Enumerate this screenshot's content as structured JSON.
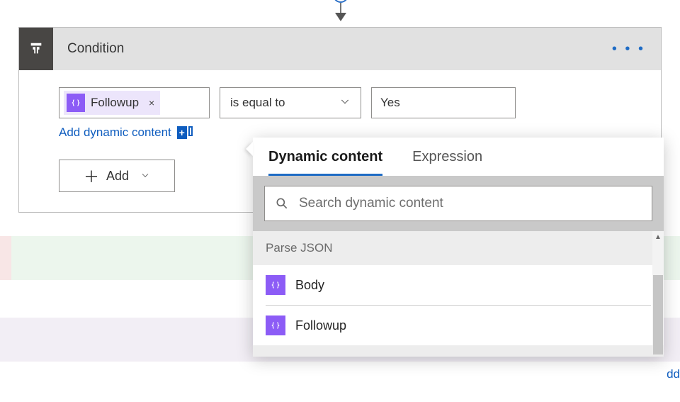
{
  "connector": {
    "plus": "+"
  },
  "card": {
    "title": "Condition",
    "more": "• • •"
  },
  "condition": {
    "token_label": "Followup",
    "token_remove": "×",
    "operator": "is equal to",
    "value": "Yes",
    "dynamic_link": "Add dynamic content",
    "add_button": "Add"
  },
  "popout": {
    "tabs": {
      "dynamic": "Dynamic content",
      "expression": "Expression"
    },
    "search_placeholder": "Search dynamic content",
    "section": "Parse JSON",
    "items": [
      "Body",
      "Followup"
    ]
  },
  "background": {
    "edge_link": "dd"
  }
}
